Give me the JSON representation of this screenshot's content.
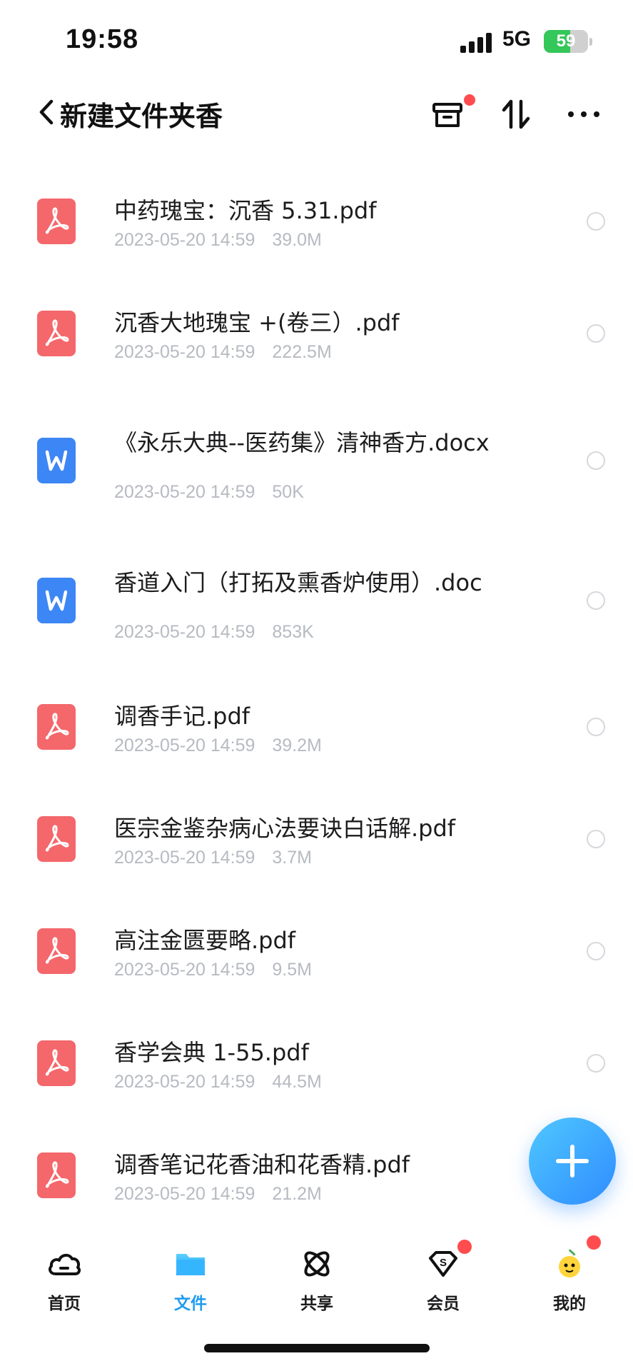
{
  "status_bar": {
    "time": "19:58",
    "network": "5G",
    "battery_level": 59,
    "battery_text": "59",
    "battery_color": "#34c759"
  },
  "nav": {
    "back_icon": "chevron-left-icon",
    "title": "新建文件夹香",
    "actions": [
      {
        "name": "transfer-box-icon",
        "has_badge": true
      },
      {
        "name": "sort-icon",
        "has_badge": false
      },
      {
        "name": "more-icon",
        "has_badge": false
      }
    ]
  },
  "files": [
    {
      "type": "pdf",
      "name": "中药瑰宝：沉香 5.31.pdf",
      "date": "2023-05-20 14:59",
      "size": "39.0M"
    },
    {
      "type": "pdf",
      "name": "沉香大地瑰宝 +(卷三）.pdf",
      "date": "2023-05-20 14:59",
      "size": "222.5M"
    },
    {
      "type": "doc",
      "name": "《永乐大典--医药集》清神香方.docx",
      "date": "2023-05-20 14:59",
      "size": "50K"
    },
    {
      "type": "doc",
      "name": "香道入门（打拓及熏香炉使用）.doc",
      "date": "2023-05-20 14:59",
      "size": "853K"
    },
    {
      "type": "pdf",
      "name": "调香手记.pdf",
      "date": "2023-05-20 14:59",
      "size": "39.2M"
    },
    {
      "type": "pdf",
      "name": "医宗金鉴杂病心法要诀白话解.pdf",
      "date": "2023-05-20 14:59",
      "size": "3.7M"
    },
    {
      "type": "pdf",
      "name": "高注金匮要略.pdf",
      "date": "2023-05-20 14:59",
      "size": "9.5M"
    },
    {
      "type": "pdf",
      "name": "香学会典 1-55.pdf",
      "date": "2023-05-20 14:59",
      "size": "44.5M"
    },
    {
      "type": "pdf",
      "name": "调香笔记花香油和花香精.pdf",
      "date": "2023-05-20 14:59",
      "size": "21.2M"
    }
  ],
  "fab": {
    "icon": "plus-icon"
  },
  "tabs": [
    {
      "label": "首页",
      "icon": "cloud-icon",
      "active": false,
      "badge": false
    },
    {
      "label": "文件",
      "icon": "folder-icon",
      "active": true,
      "badge": false
    },
    {
      "label": "共享",
      "icon": "share-orbit-icon",
      "active": false,
      "badge": false
    },
    {
      "label": "会员",
      "icon": "vip-diamond-icon",
      "active": false,
      "badge": true
    },
    {
      "label": "我的",
      "icon": "mascot-avatar-icon",
      "active": false,
      "badge": true
    }
  ],
  "colors": {
    "accent": "#1e9bf0",
    "pdf": "#f4676b",
    "doc": "#3d86f5",
    "badge": "#ff4d4f",
    "meta_text": "#b7bac1"
  }
}
